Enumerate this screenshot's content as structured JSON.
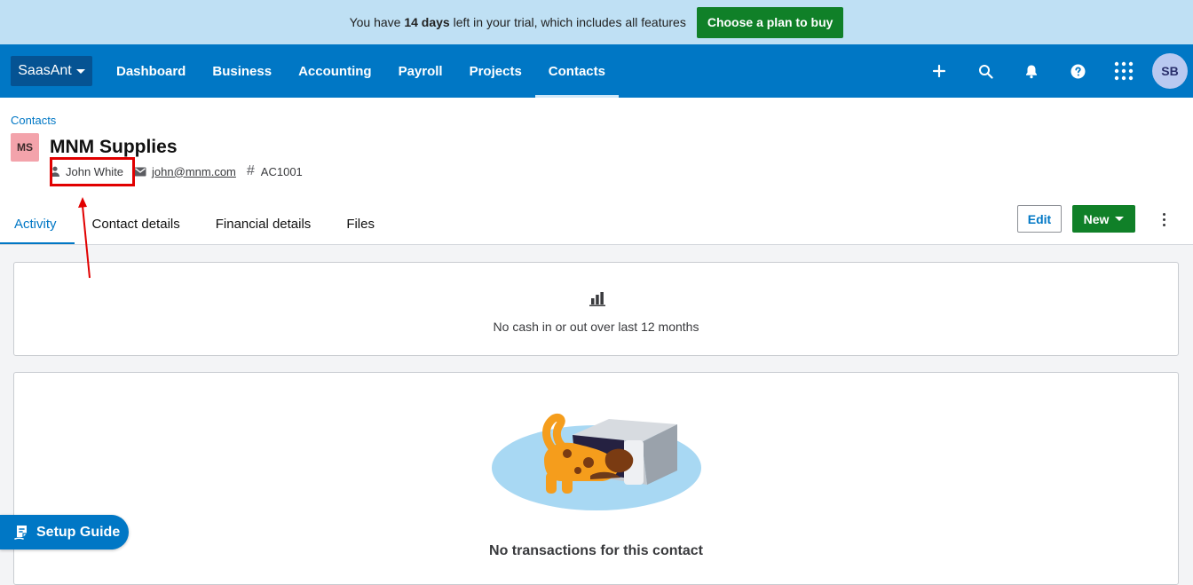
{
  "trial_banner": {
    "text_before": "You have ",
    "days": "14 days",
    "text_after": " left in your trial, which includes all features",
    "cta_label": "Choose a plan to buy"
  },
  "navbar": {
    "brand": "SaasAnt",
    "items": [
      {
        "label": "Dashboard"
      },
      {
        "label": "Business"
      },
      {
        "label": "Accounting"
      },
      {
        "label": "Payroll"
      },
      {
        "label": "Projects"
      },
      {
        "label": "Contacts",
        "active": true
      }
    ],
    "icons": [
      "plus-icon",
      "search-icon",
      "bell-icon",
      "help-icon",
      "apps-grid-icon"
    ],
    "avatar_initials": "SB"
  },
  "contact": {
    "breadcrumb": "Contacts",
    "initials": "MS",
    "name": "MNM Supplies",
    "person": "John White",
    "email": "john@mnm.com",
    "account_symbol": "#",
    "account_number": "AC1001"
  },
  "tabs": [
    {
      "label": "Activity",
      "active": true
    },
    {
      "label": "Contact details"
    },
    {
      "label": "Financial details"
    },
    {
      "label": "Files"
    }
  ],
  "actions": {
    "edit_label": "Edit",
    "new_label": "New"
  },
  "cash_card": {
    "message": "No cash in or out over last 12 months"
  },
  "transactions_card": {
    "message": "No transactions for this contact"
  },
  "setup_guide": {
    "label": "Setup Guide"
  },
  "colors": {
    "brand_blue": "#0077c5",
    "primary_green": "#108028",
    "annotation_red": "#e10000"
  }
}
